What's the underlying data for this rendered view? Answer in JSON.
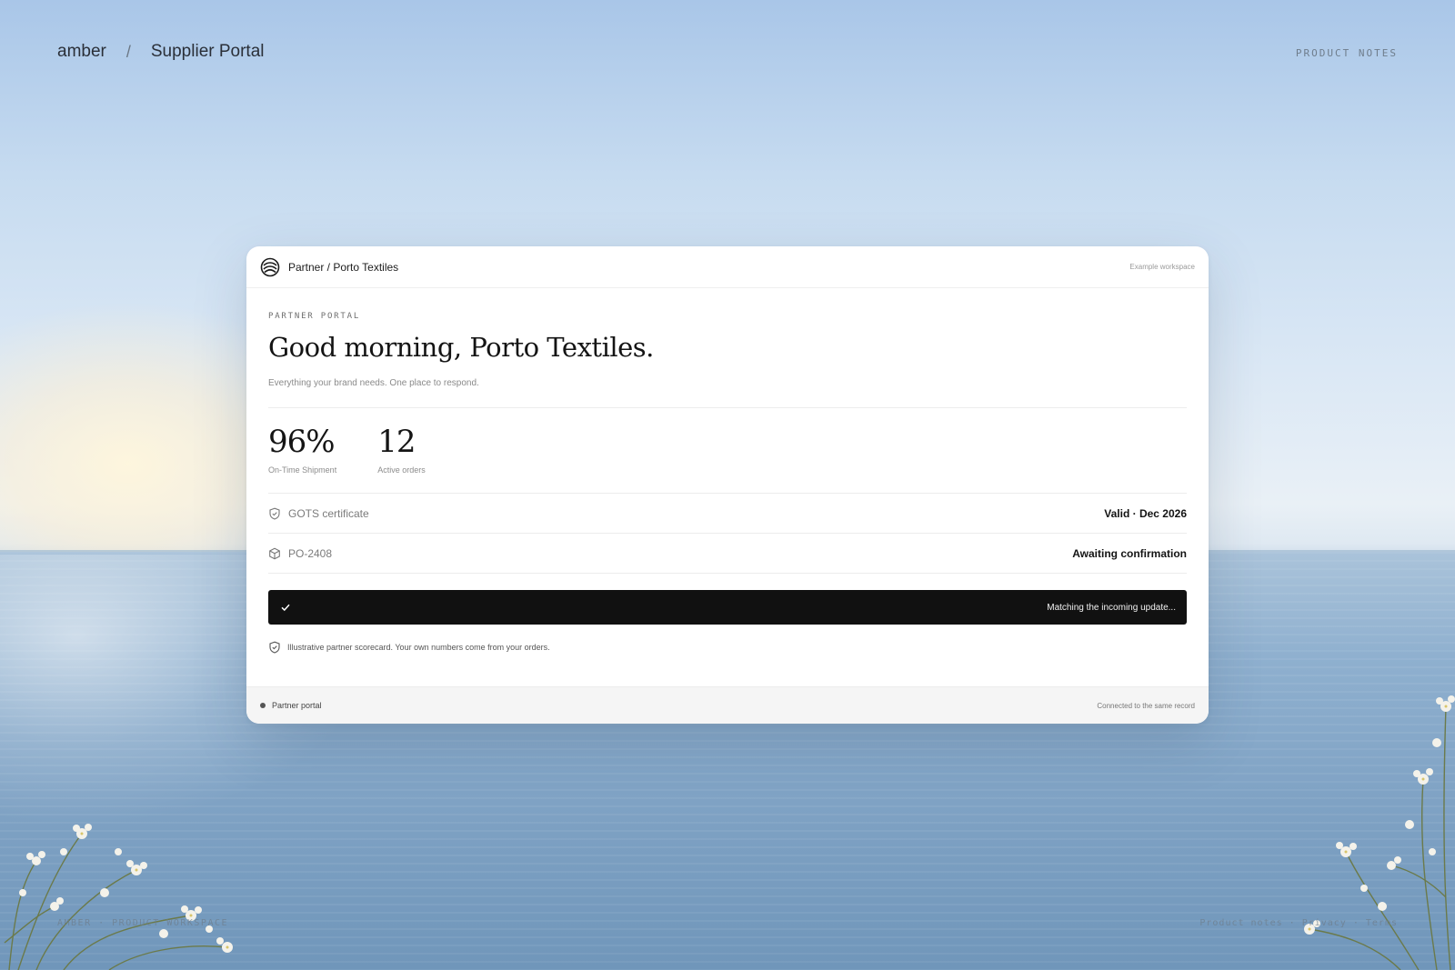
{
  "header": {
    "brand": "amber",
    "separator": "/",
    "product": "Supplier Portal",
    "notes_link": "PRODUCT NOTES"
  },
  "card": {
    "breadcrumb": "Partner / Porto Textiles",
    "workspace_tag": "Example workspace",
    "eyebrow": "PARTNER PORTAL",
    "greeting": "Good morning, Porto Textiles.",
    "subline": "Everything your brand needs. One place to respond.",
    "stats": [
      {
        "value": "96%",
        "label": "On-Time Shipment"
      },
      {
        "value": "12",
        "label": "Active orders"
      }
    ],
    "rows": [
      {
        "icon": "shield-check-icon",
        "name": "GOTS certificate",
        "value": "Valid · Dec 2026"
      },
      {
        "icon": "package-icon",
        "name": "PO-2408",
        "value": "Awaiting confirmation"
      }
    ],
    "status_bar": {
      "icon": "check-icon",
      "message": "Matching the incoming update..."
    },
    "note": "Illustrative partner scorecard. Your own numbers come from your orders.",
    "footer": {
      "left": "Partner portal",
      "right": "Connected to the same record"
    }
  },
  "page_footer": {
    "left": "AMBER · PRODUCT WORKSPACE",
    "right": "Product notes · Privacy · Terms"
  },
  "colors": {
    "sky_top": "#a9c6e8",
    "sea": "#7fa2c4",
    "status_bar": "#111111",
    "card": "#ffffff"
  }
}
